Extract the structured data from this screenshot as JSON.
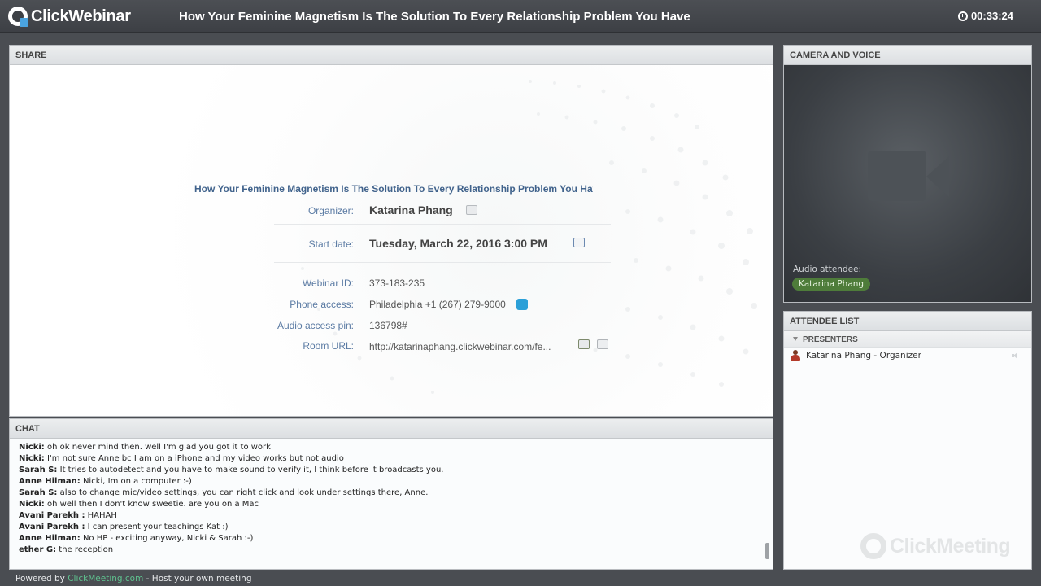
{
  "app": {
    "logo_text": "ClickWebinar",
    "title": "How Your Feminine Magnetism Is The Solution To Every Relationship Problem You Have",
    "timer": "00:33:24"
  },
  "share": {
    "header": "SHARE",
    "info_title": "How Your Feminine Magnetism Is The Solution To Every Relationship Problem You Have",
    "organizer_label": "Organizer:",
    "organizer_value": "Katarina Phang",
    "start_label": "Start date:",
    "start_value": "Tuesday, March 22, 2016 3:00 PM",
    "webinar_id_label": "Webinar ID:",
    "webinar_id_value": "373-183-235",
    "phone_label": "Phone access:",
    "phone_value": "Philadelphia +1 (267) 279-9000",
    "pin_label": "Audio access pin:",
    "pin_value": "136798#",
    "room_label": "Room URL:",
    "room_value": "http://katarinaphang.clickwebinar.com/fe..."
  },
  "chat": {
    "header": "CHAT",
    "messages": [
      {
        "name": "Nicki:",
        "text": "oh ok never mind then. well I'm glad you got it to work"
      },
      {
        "name": "Nicki:",
        "text": "I'm not sure Anne bc I am on a iPhone and my video works but not audio"
      },
      {
        "name": "Sarah S:",
        "text": "It tries to autodetect and you have to make sound to verify it, I think before it broadcasts you."
      },
      {
        "name": "Anne Hilman:",
        "text": "Nicki, Im on a computer :-)"
      },
      {
        "name": "Sarah S:",
        "text": "also to change mic/video settings, you can right click and look under settings there, Anne."
      },
      {
        "name": "Nicki:",
        "text": "oh well then I don't know sweetie. are you on a Mac"
      },
      {
        "name": "Avani  Parekh :",
        "text": "HAHAH"
      },
      {
        "name": "Avani  Parekh :",
        "text": "I can present your teachings Kat :)"
      },
      {
        "name": "Anne Hilman:",
        "text": "No HP - exciting anyway, Nicki & Sarah :-)"
      },
      {
        "name": "ether G:",
        "text": "the reception"
      }
    ]
  },
  "footer": {
    "prefix": "Powered by",
    "link": "ClickMeeting.com",
    "suffix": "- Host your own meeting"
  },
  "camera": {
    "header": "CAMERA AND VOICE",
    "audio_label": "Audio attendee:",
    "audio_name": "Katarina Phang"
  },
  "attendees": {
    "header": "ATTENDEE LIST",
    "group": "PRESENTERS",
    "items": [
      {
        "label": "Katarina Phang - Organizer"
      }
    ],
    "watermark": "ClickMeeting"
  }
}
